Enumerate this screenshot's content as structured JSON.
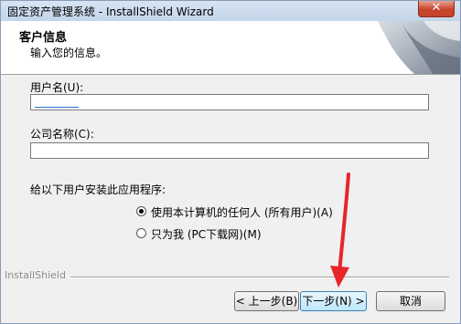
{
  "window": {
    "title": "固定资产管理系统 - InstallShield Wizard",
    "close_glyph": "✕"
  },
  "header": {
    "title": "客户信息",
    "subtitle": "输入您的信息。"
  },
  "form": {
    "user_name_label": "用户名(U):",
    "user_name_value": "",
    "company_label": "公司名称(C):",
    "company_value": "",
    "install_for_label": "给以下用户安装此应用程序:",
    "options": [
      {
        "label": "使用本计算机的任何人 (所有用户)(A)",
        "checked": true
      },
      {
        "label": "只为我 (PC下载网)(M)",
        "checked": false
      }
    ]
  },
  "footer": {
    "brand": "InstallShield",
    "back_label": "< 上一步(B)",
    "next_label": "下一步(N) >",
    "cancel_label": "取消"
  },
  "colors": {
    "annotation_arrow": "#e8262a",
    "accent": "#3c7fb1"
  }
}
